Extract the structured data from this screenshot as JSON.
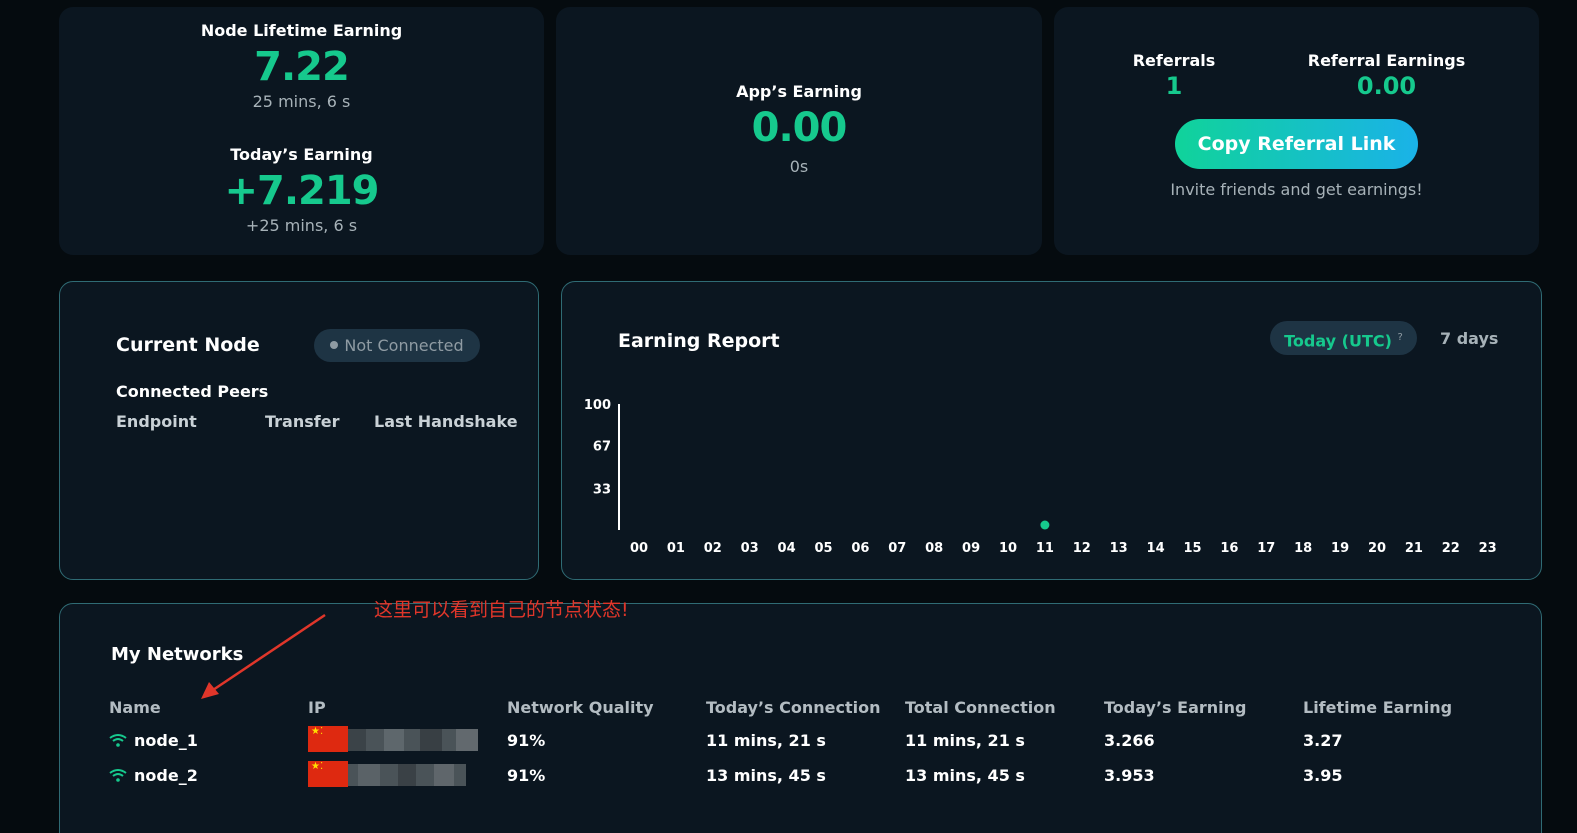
{
  "node_card": {
    "lifetime_label": "Node Lifetime Earning",
    "lifetime_value": "7.22",
    "lifetime_time": "25 mins, 6 s",
    "today_label": "Today’s Earning",
    "today_value": "+7.219",
    "today_time": "+25 mins, 6 s"
  },
  "app_card": {
    "label": "App’s Earning",
    "value": "0.00",
    "time": "0s"
  },
  "referral_card": {
    "referrals_label": "Referrals",
    "referrals_value": "1",
    "earnings_label": "Referral Earnings",
    "earnings_value": "0.00",
    "copy_button": "Copy Referral Link",
    "invite_text": "Invite friends and get earnings!"
  },
  "current_node": {
    "title": "Current Node",
    "status": "Not Connected",
    "peers_title": "Connected Peers",
    "columns": [
      "Endpoint",
      "Transfer",
      "Last Handshake"
    ]
  },
  "earning_report": {
    "title": "Earning Report",
    "range_today": "Today (UTC)",
    "range_today_hint": "?",
    "range_7days": "7 days"
  },
  "chart_data": {
    "type": "scatter",
    "categories": [
      "00",
      "01",
      "02",
      "03",
      "04",
      "05",
      "06",
      "07",
      "08",
      "09",
      "10",
      "11",
      "12",
      "13",
      "14",
      "15",
      "16",
      "17",
      "18",
      "19",
      "20",
      "21",
      "22",
      "23"
    ],
    "values": [
      null,
      null,
      null,
      null,
      null,
      null,
      null,
      null,
      null,
      null,
      null,
      0,
      null,
      null,
      null,
      null,
      null,
      null,
      null,
      null,
      null,
      null,
      null,
      null
    ],
    "y_ticks": [
      "100",
      "67",
      "33"
    ],
    "ylim": [
      0,
      100
    ],
    "title": "Earning Report",
    "point_color": "#16c98d"
  },
  "networks": {
    "title": "My Networks",
    "columns": [
      "Name",
      "IP",
      "Network Quality",
      "Today’s Connection",
      "Total Connection",
      "Today’s Earning",
      "Lifetime Earning"
    ],
    "rows": [
      {
        "name": "node_1",
        "quality": "91%",
        "today_conn": "11 mins, 21 s",
        "total_conn": "11 mins, 21 s",
        "today_earning": "3.266",
        "lifetime_earning": "3.27"
      },
      {
        "name": "node_2",
        "quality": "91%",
        "today_conn": "13 mins, 45 s",
        "total_conn": "13 mins, 45 s",
        "today_earning": "3.953",
        "lifetime_earning": "3.95"
      }
    ]
  },
  "annotation": {
    "text": "这里可以看到自己的节点状态!",
    "color": "#e0362a"
  },
  "colors": {
    "accent": "#16c98d",
    "background": "#050b0f",
    "card": "#0b1620",
    "card_border": "#2f6b74",
    "button_gradient_start": "#10d39a",
    "button_gradient_end": "#1ab2e8"
  }
}
